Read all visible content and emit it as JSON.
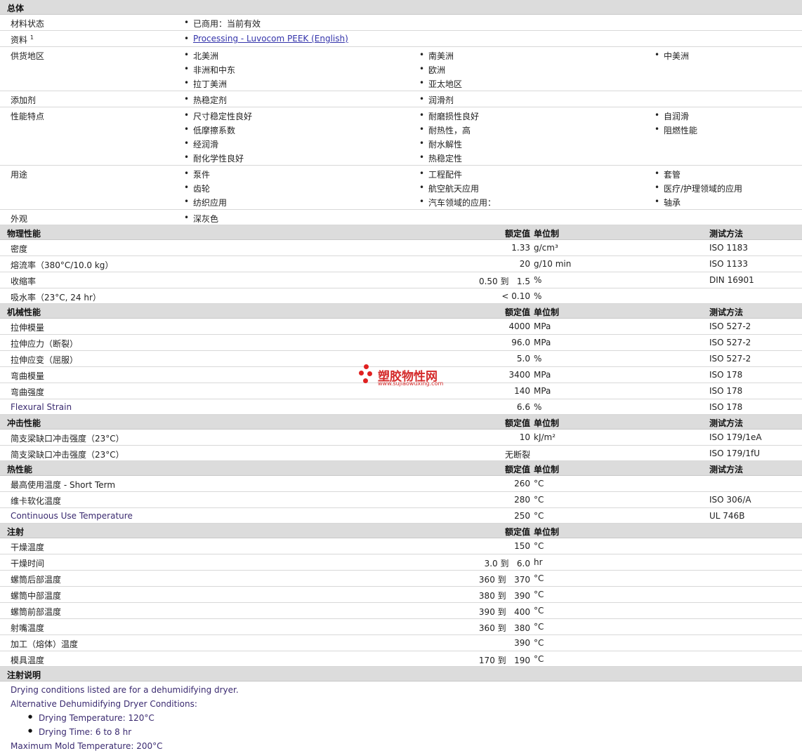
{
  "general": {
    "title": "总体",
    "material_status_label": "材料状态",
    "material_status": "已商用：当前有效",
    "doc_label": "资料",
    "doc_sup": "1",
    "doc_link": "Processing - Luvocom PEEK (English)",
    "regions_label": "供货地区",
    "regions": [
      "北美洲",
      "南美洲",
      "中美洲",
      "非洲和中东",
      "欧洲",
      "拉丁美洲",
      "亚太地区"
    ],
    "additives_label": "添加剂",
    "additives": [
      "热稳定剂",
      "润滑剂"
    ],
    "features_label": "性能特点",
    "features": [
      "尺寸稳定性良好",
      "耐磨损性良好",
      "自润滑",
      "低摩擦系数",
      "耐热性，高",
      "阻燃性能",
      "经润滑",
      "耐水解性",
      "耐化学性良好",
      "热稳定性"
    ],
    "uses_label": "用途",
    "uses": [
      "泵件",
      "工程配件",
      "套管",
      "齿轮",
      "航空航天应用",
      "医疗/护理领域的应用",
      "纺织应用",
      "汽车领域的应用：",
      "轴承"
    ],
    "appearance_label": "外观",
    "appearance": "深灰色"
  },
  "headers": {
    "nominal": "额定值",
    "unit": "单位制",
    "method": "测试方法"
  },
  "physical": {
    "title": "物理性能",
    "rows": [
      {
        "label": "密度",
        "value": "1.33",
        "unit": "g/cm³",
        "method": "ISO 1183"
      },
      {
        "label": "熔流率（380°C/10.0 kg）",
        "value": "20",
        "unit": "g/10 min",
        "method": "ISO 1133"
      },
      {
        "label": "收缩率",
        "value": "0.50 到   1.5",
        "unit": "%",
        "method": "DIN 16901"
      },
      {
        "label": "吸水率（23°C, 24 hr）",
        "value": "< 0.10",
        "unit": "%",
        "method": ""
      }
    ]
  },
  "mechanical": {
    "title": "机械性能",
    "rows": [
      {
        "label": "拉伸模量",
        "value": "4000",
        "unit": "MPa",
        "method": "ISO 527-2"
      },
      {
        "label": "拉伸应力（断裂）",
        "value": "96.0",
        "unit": "MPa",
        "method": "ISO 527-2"
      },
      {
        "label": "拉伸应变（屈服）",
        "value": "5.0",
        "unit": "%",
        "method": "ISO 527-2"
      },
      {
        "label": "弯曲模量",
        "value": "3400",
        "unit": "MPa",
        "method": "ISO 178"
      },
      {
        "label": "弯曲强度",
        "value": "140",
        "unit": "MPa",
        "method": "ISO 178"
      },
      {
        "label": "Flexural Strain",
        "value": "6.6",
        "unit": "%",
        "method": "ISO 178"
      }
    ]
  },
  "impact": {
    "title": "冲击性能",
    "rows": [
      {
        "label": "简支梁缺口冲击强度（23°C）",
        "value": "10",
        "unit": "kJ/m²",
        "method": "ISO 179/1eA"
      },
      {
        "label": "简支梁缺口冲击强度（23°C）",
        "value": "无断裂",
        "unit": "",
        "method": "ISO 179/1fU"
      }
    ]
  },
  "thermal": {
    "title": "热性能",
    "rows": [
      {
        "label": "最高使用温度 - Short Term",
        "value": "260",
        "unit": "°C",
        "method": ""
      },
      {
        "label": "维卡软化温度",
        "value": "280",
        "unit": "°C",
        "method": "ISO 306/A"
      },
      {
        "label": "Continuous Use Temperature",
        "value": "250",
        "unit": "°C",
        "method": "UL 746B"
      }
    ]
  },
  "injection": {
    "title": "注射",
    "rows": [
      {
        "label": "干燥温度",
        "value": "150",
        "unit": "°C",
        "method": ""
      },
      {
        "label": "干燥时间",
        "value": "3.0 到   6.0",
        "unit": "hr",
        "method": ""
      },
      {
        "label": "螺筒后部温度",
        "value": "360 到   370",
        "unit": "°C",
        "method": ""
      },
      {
        "label": "螺筒中部温度",
        "value": "380 到   390",
        "unit": "°C",
        "method": ""
      },
      {
        "label": "螺筒前部温度",
        "value": "390 到   400",
        "unit": "°C",
        "method": ""
      },
      {
        "label": "射嘴温度",
        "value": "360 到   380",
        "unit": "°C",
        "method": ""
      },
      {
        "label": "加工（熔体）温度",
        "value": "390",
        "unit": "°C",
        "method": ""
      },
      {
        "label": "模具温度",
        "value": "170 到   190",
        "unit": "°C",
        "method": ""
      }
    ]
  },
  "notes": {
    "title": "注射说明",
    "line1": "Drying conditions listed are for a dehumidifying dryer.",
    "line2": "Alternative Dehumidifying Dryer Conditions:",
    "bullet1": "Drying Temperature: 120°C",
    "bullet2": "Drying Time: 6 to 8 hr",
    "line3": "Maximum Mold Temperature: 200°C"
  },
  "watermark": {
    "name": "塑胶物性网",
    "url": "www.sujiaowuxing.com",
    "color": "#d42a2a"
  }
}
